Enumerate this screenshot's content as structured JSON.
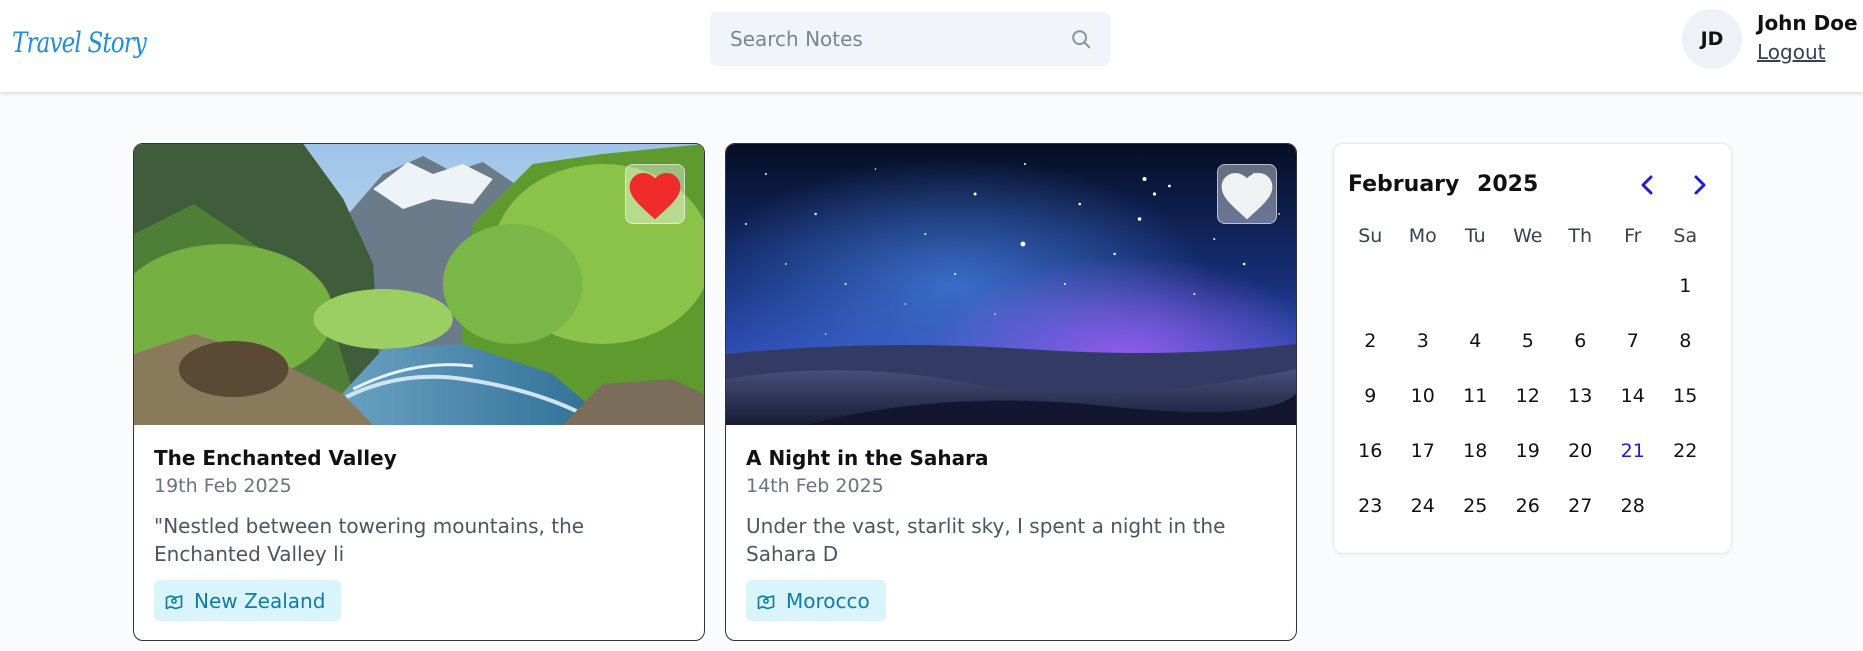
{
  "header": {
    "logo": "Travel Story",
    "search_placeholder": "Search Notes",
    "search_icon": "search-icon",
    "user": {
      "initials": "JD",
      "name": "John Doe",
      "logout_label": "Logout"
    }
  },
  "stories": [
    {
      "title": "The Enchanted Valley",
      "date": "19th Feb 2025",
      "excerpt": "\"Nestled between towering mountains, the Enchanted Valley li",
      "location": "New Zealand",
      "favorite": true,
      "image": "mountain valley with river and forest"
    },
    {
      "title": "A Night in the Sahara",
      "date": "14th Feb 2025",
      "excerpt": "Under the vast, starlit sky, I spent a night in the Sahara D",
      "location": "Morocco",
      "favorite": false,
      "image": "starry night sky over desert dunes"
    }
  ],
  "calendar": {
    "month": "February",
    "year": "2025",
    "weekdays": [
      "Su",
      "Mo",
      "Tu",
      "We",
      "Th",
      "Fr",
      "Sa"
    ],
    "leading_blank_days": 6,
    "days": [
      "1",
      "2",
      "3",
      "4",
      "5",
      "6",
      "7",
      "8",
      "9",
      "10",
      "11",
      "12",
      "13",
      "14",
      "15",
      "16",
      "17",
      "18",
      "19",
      "20",
      "21",
      "22",
      "23",
      "24",
      "25",
      "26",
      "27",
      "28"
    ],
    "today": "21"
  },
  "colors": {
    "brand": "#1e8fd8",
    "favorite_active": "#ef2b2b",
    "favorite_inactive": "#ffffff",
    "tag_bg": "#d9f4fb",
    "tag_text": "#0e7da3",
    "today": "#1d1dd6",
    "nav_arrows": "#1d1dd6"
  }
}
